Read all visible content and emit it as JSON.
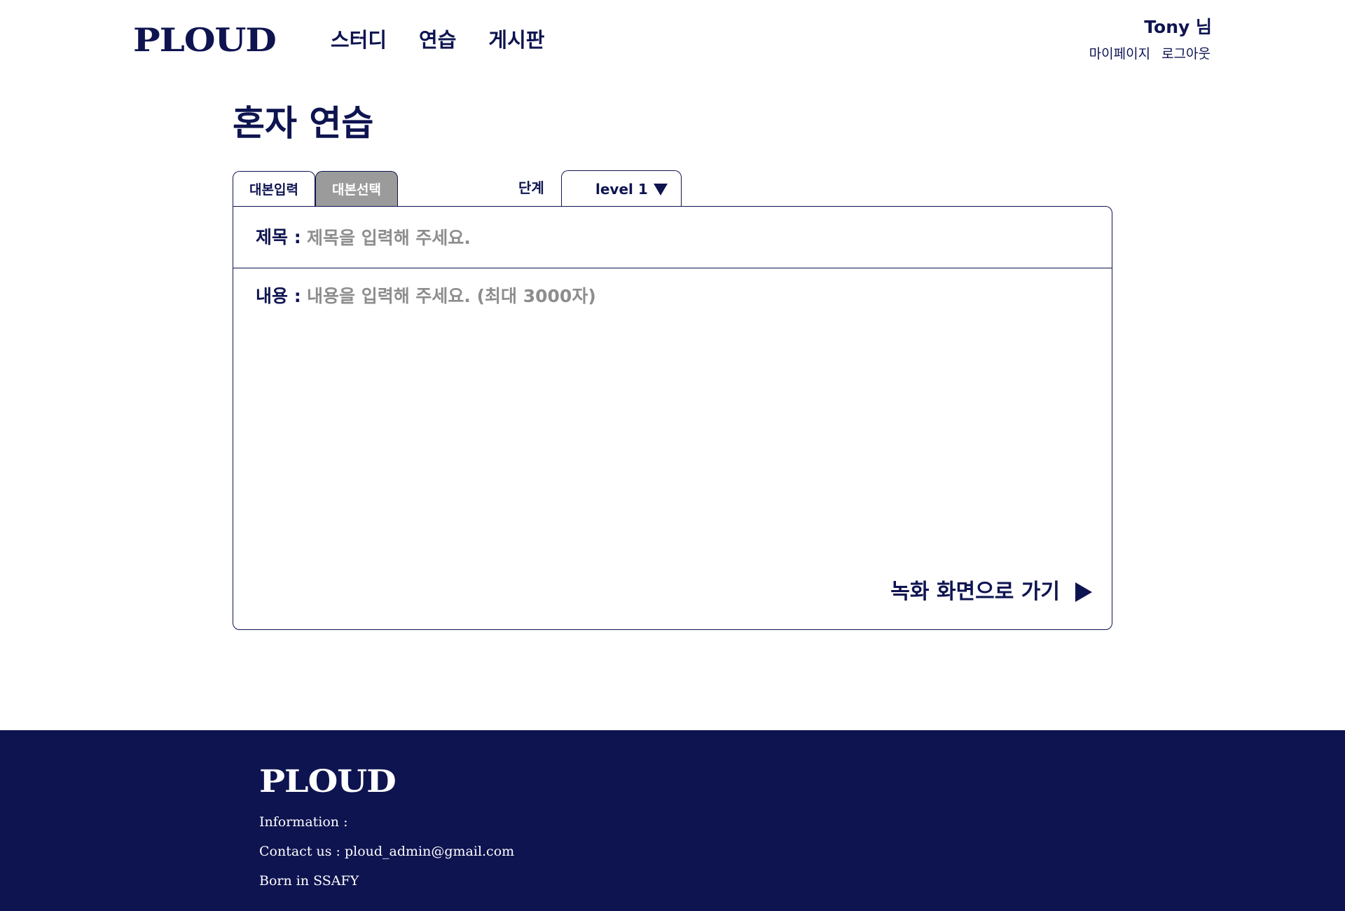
{
  "header": {
    "logo": "PLOUD",
    "nav": [
      "스터디",
      "연습",
      "게시판"
    ],
    "user_name": "Tony 님",
    "user_links": [
      "마이페이지",
      "로그아웃"
    ]
  },
  "main": {
    "title": "혼자 연습",
    "tabs": [
      {
        "label": "대본입력",
        "selected": false
      },
      {
        "label": "대본선택",
        "selected": true
      }
    ],
    "level_label": "단계",
    "level_value": "level 1",
    "title_field": {
      "label": "제목 :",
      "placeholder": "제목을 입력해 주세요.",
      "value": ""
    },
    "content_field": {
      "label": "내용 :",
      "placeholder": "내용을 입력해 주세요. (최대 3000자)",
      "value": ""
    },
    "go_record_label": "녹화 화면으로 가기"
  },
  "footer": {
    "logo": "PLOUD",
    "information": "Information :",
    "contact": "Contact us :  ploud_admin@gmail.com",
    "born": "Born in SSAFY"
  },
  "colors": {
    "brand_navy": "#0e1450",
    "tab_selected_bg": "#9b9b9b",
    "placeholder": "#8d8d8d",
    "background": "#ffffff"
  },
  "icons": {
    "dropdown": "triangle-down-icon",
    "go": "play-icon"
  }
}
